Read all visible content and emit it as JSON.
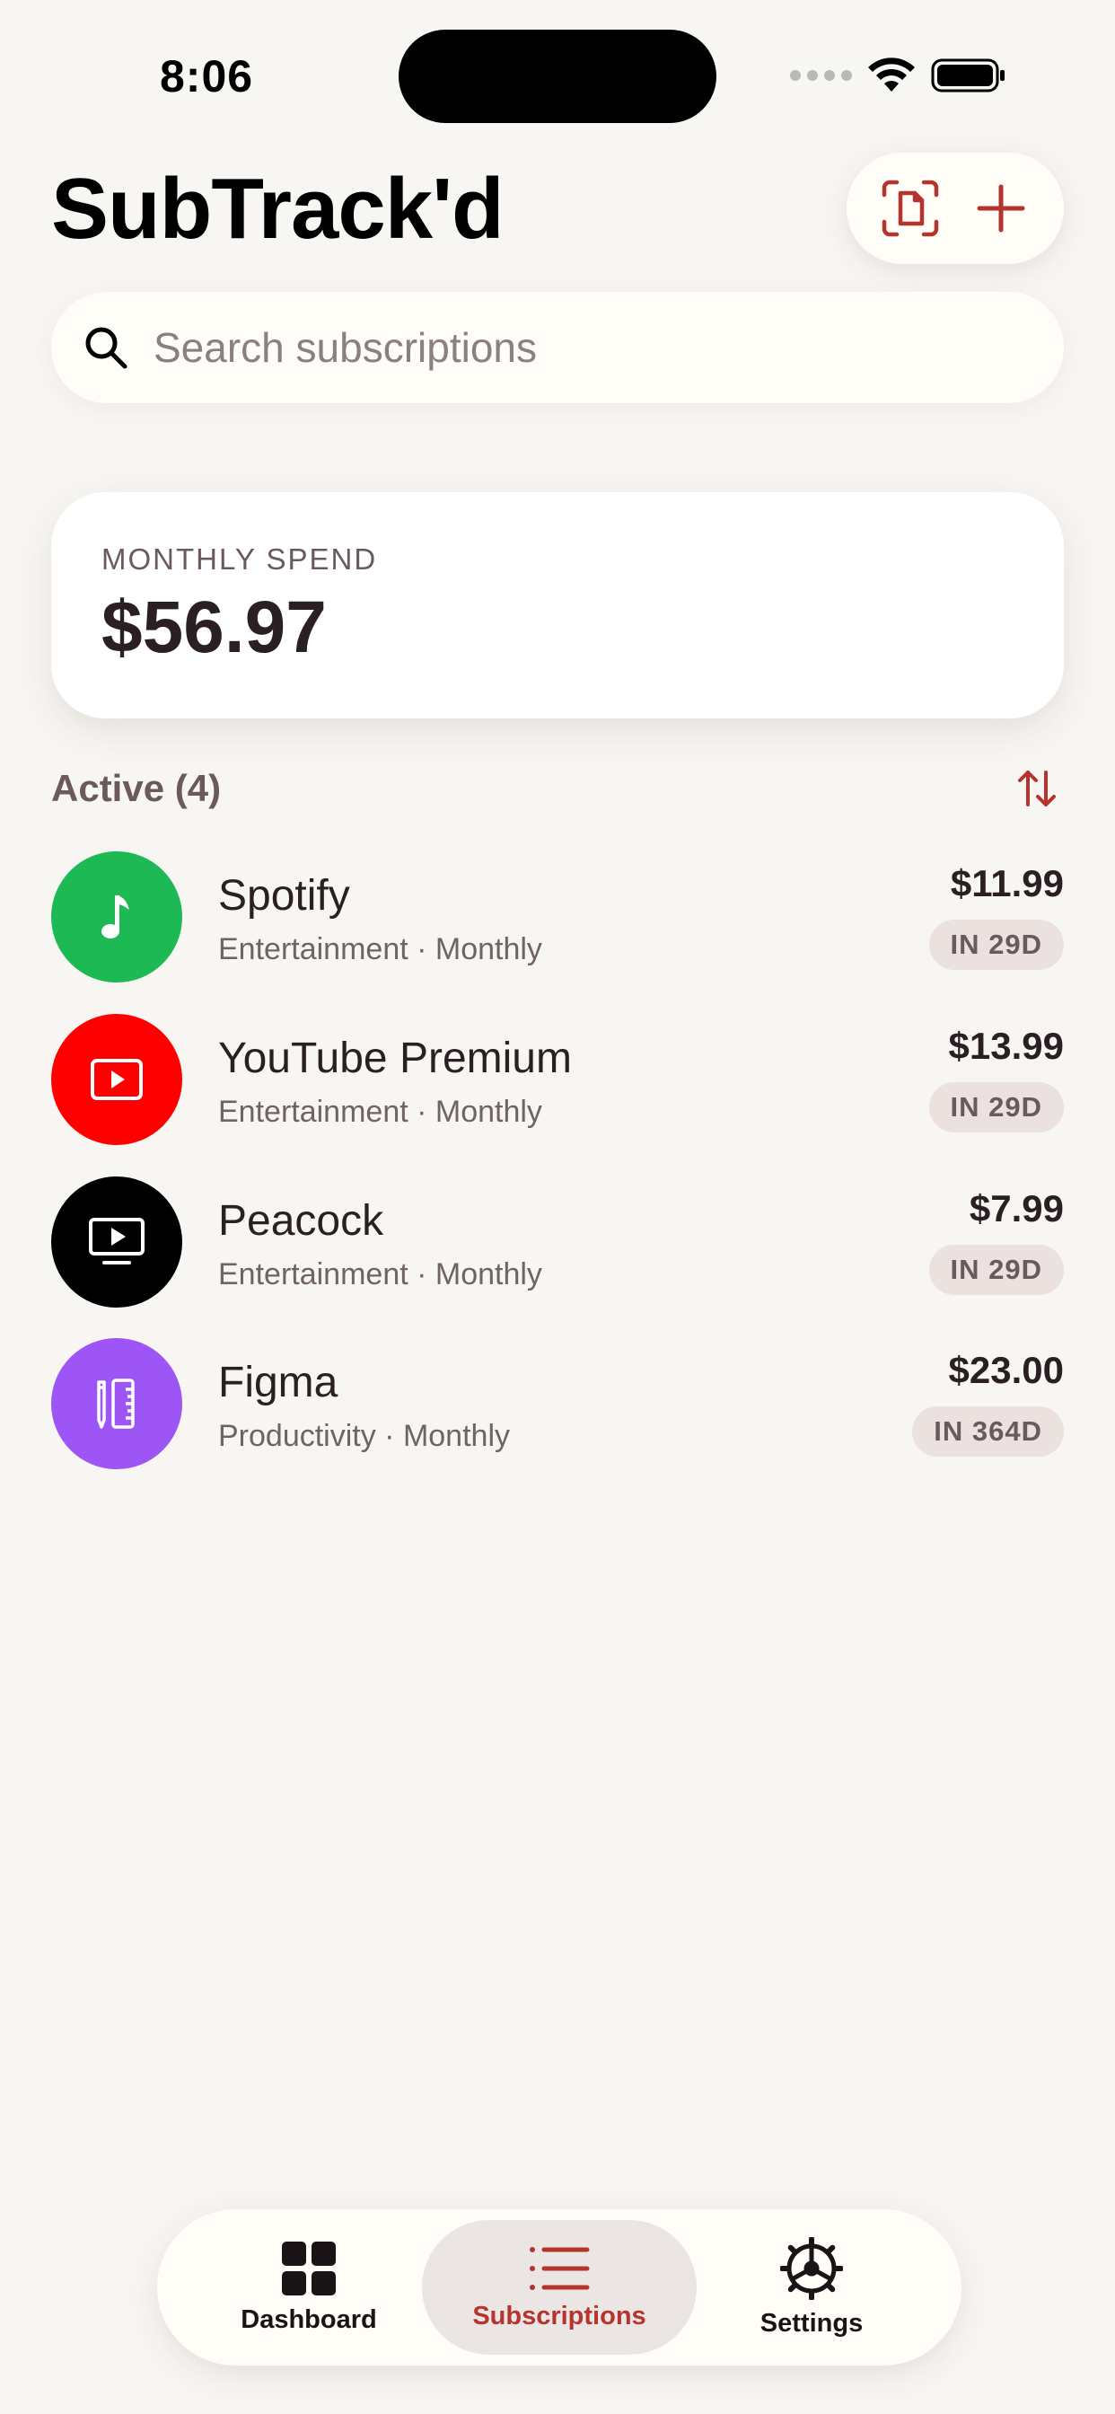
{
  "status_bar": {
    "time": "8:06"
  },
  "header": {
    "title": "SubTrack'd"
  },
  "search": {
    "placeholder": "Search subscriptions",
    "value": ""
  },
  "summary": {
    "label": "MONTHLY SPEND",
    "value": "$56.97"
  },
  "list": {
    "title": "Active (4)",
    "items": [
      {
        "name": "Spotify",
        "meta": "Entertainment · Monthly",
        "price": "$11.99",
        "due": "IN 29D",
        "color": "#1db954",
        "icon": "music-note-icon"
      },
      {
        "name": "YouTube Premium",
        "meta": "Entertainment · Monthly",
        "price": "$13.99",
        "due": "IN 29D",
        "color": "#ff0000",
        "icon": "play-rectangle-icon"
      },
      {
        "name": "Peacock",
        "meta": "Entertainment · Monthly",
        "price": "$7.99",
        "due": "IN 29D",
        "color": "#000000",
        "icon": "tv-play-icon"
      },
      {
        "name": "Figma",
        "meta": "Productivity · Monthly",
        "price": "$23.00",
        "due": "IN 364D",
        "color": "#9d55f5",
        "icon": "pencil-ruler-icon"
      }
    ]
  },
  "tabbar": {
    "tabs": [
      {
        "label": "Dashboard",
        "icon": "grid-icon",
        "active": false
      },
      {
        "label": "Subscriptions",
        "icon": "list-icon",
        "active": true
      },
      {
        "label": "Settings",
        "icon": "gear-icon",
        "active": false
      }
    ]
  },
  "colors": {
    "accent": "#b5342e",
    "background": "#f8f6f3"
  }
}
